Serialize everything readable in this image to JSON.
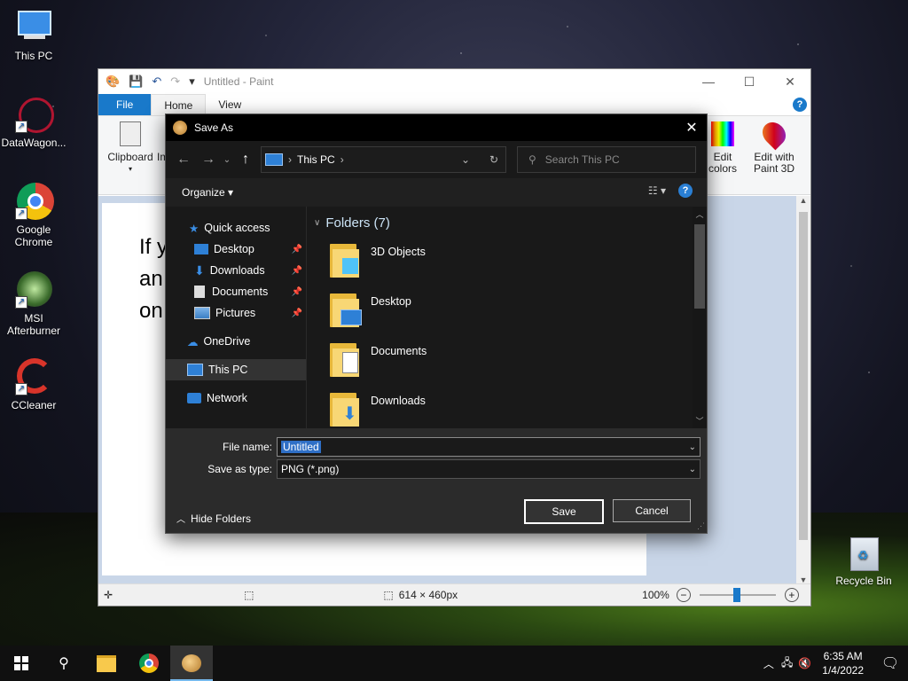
{
  "desktop": {
    "icons": [
      {
        "label": "This PC",
        "icon": "computer-icon"
      },
      {
        "label": "DataWagon...",
        "icon": "datawagon-icon"
      },
      {
        "label": "Google Chrome",
        "icon": "chrome-icon"
      },
      {
        "label": "MSI Afterburner",
        "icon": "msi-afterburner-icon"
      },
      {
        "label": "CCleaner",
        "icon": "ccleaner-icon"
      },
      {
        "label": "Recycle Bin",
        "icon": "recycle-bin-icon"
      }
    ]
  },
  "paint": {
    "title": "Untitled - Paint",
    "tabs": {
      "file": "File",
      "home": "Home",
      "view": "View"
    },
    "ribbon": {
      "clipboard": "Clipboard",
      "image_partial": "Im",
      "edit_colors_1": "Edit",
      "edit_colors_2": "colors",
      "paint3d_1": "Edit with",
      "paint3d_2": "Paint 3D"
    },
    "canvas_text": [
      "If y",
      "an",
      "on"
    ],
    "status": {
      "size": "614 × 460px",
      "zoom": "100%"
    }
  },
  "dialog": {
    "title": "Save As",
    "address": {
      "location": "This PC"
    },
    "search_placeholder": "Search This PC",
    "organize": "Organize",
    "nav": {
      "quick_access": "Quick access",
      "items": [
        "Desktop",
        "Downloads",
        "Documents",
        "Pictures"
      ],
      "onedrive": "OneDrive",
      "this_pc": "This PC",
      "network": "Network"
    },
    "group_header": "Folders (7)",
    "folders": [
      "3D Objects",
      "Desktop",
      "Documents",
      "Downloads"
    ],
    "file_name_label": "File name:",
    "file_name_value": "Untitled",
    "save_type_label": "Save as type:",
    "save_type_value": "PNG (*.png)",
    "hide_folders": "Hide Folders",
    "save": "Save",
    "cancel": "Cancel"
  },
  "taskbar": {
    "time": "6:35 AM",
    "date": "1/4/2022"
  },
  "colors": {
    "accent": "#1979ca",
    "dialog_bg": "#202020",
    "selection": "#2f6fc6"
  }
}
